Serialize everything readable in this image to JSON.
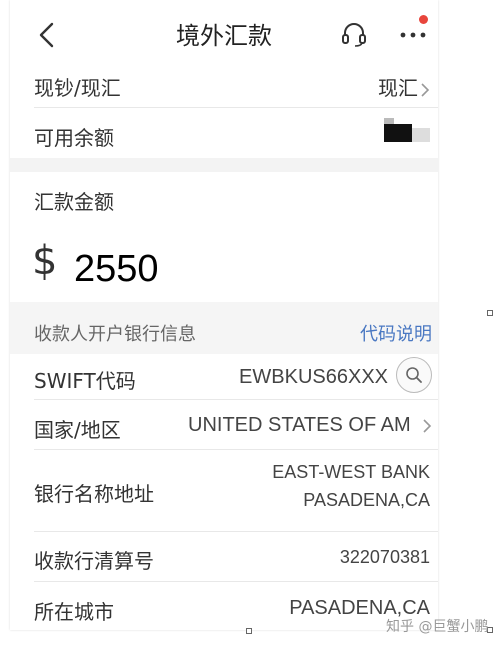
{
  "nav": {
    "title": "境外汇款"
  },
  "form": {
    "cash_label": "现钞/现汇",
    "cash_value": "现汇",
    "balance_label": "可用余额",
    "amount_label": "汇款金额",
    "currency_symbol": "$",
    "amount_value": "2550"
  },
  "bank_section": {
    "title": "收款人开户银行信息",
    "link": "代码说明",
    "swift_label": "SWIFT代码",
    "swift_value": "EWBKUS66XXX",
    "country_label": "国家/地区",
    "country_value": "UNITED STATES OF AM",
    "bank_label": "银行名称地址",
    "bank_name": "EAST-WEST BANK",
    "bank_city": "PASADENA,CA",
    "clearing_label": "收款行清算号",
    "clearing_value": "322070381",
    "city_label": "所在城市",
    "city_value": "PASADENA,CA"
  },
  "watermark": "知乎 @巨蟹小鹏",
  "colors": {
    "highlight": "#e0323a",
    "link": "#4a78c2",
    "badge": "#e8453c"
  },
  "icons": [
    "back-arrow-icon",
    "headset-icon",
    "more-icon",
    "chevron-right-icon",
    "search-icon"
  ]
}
